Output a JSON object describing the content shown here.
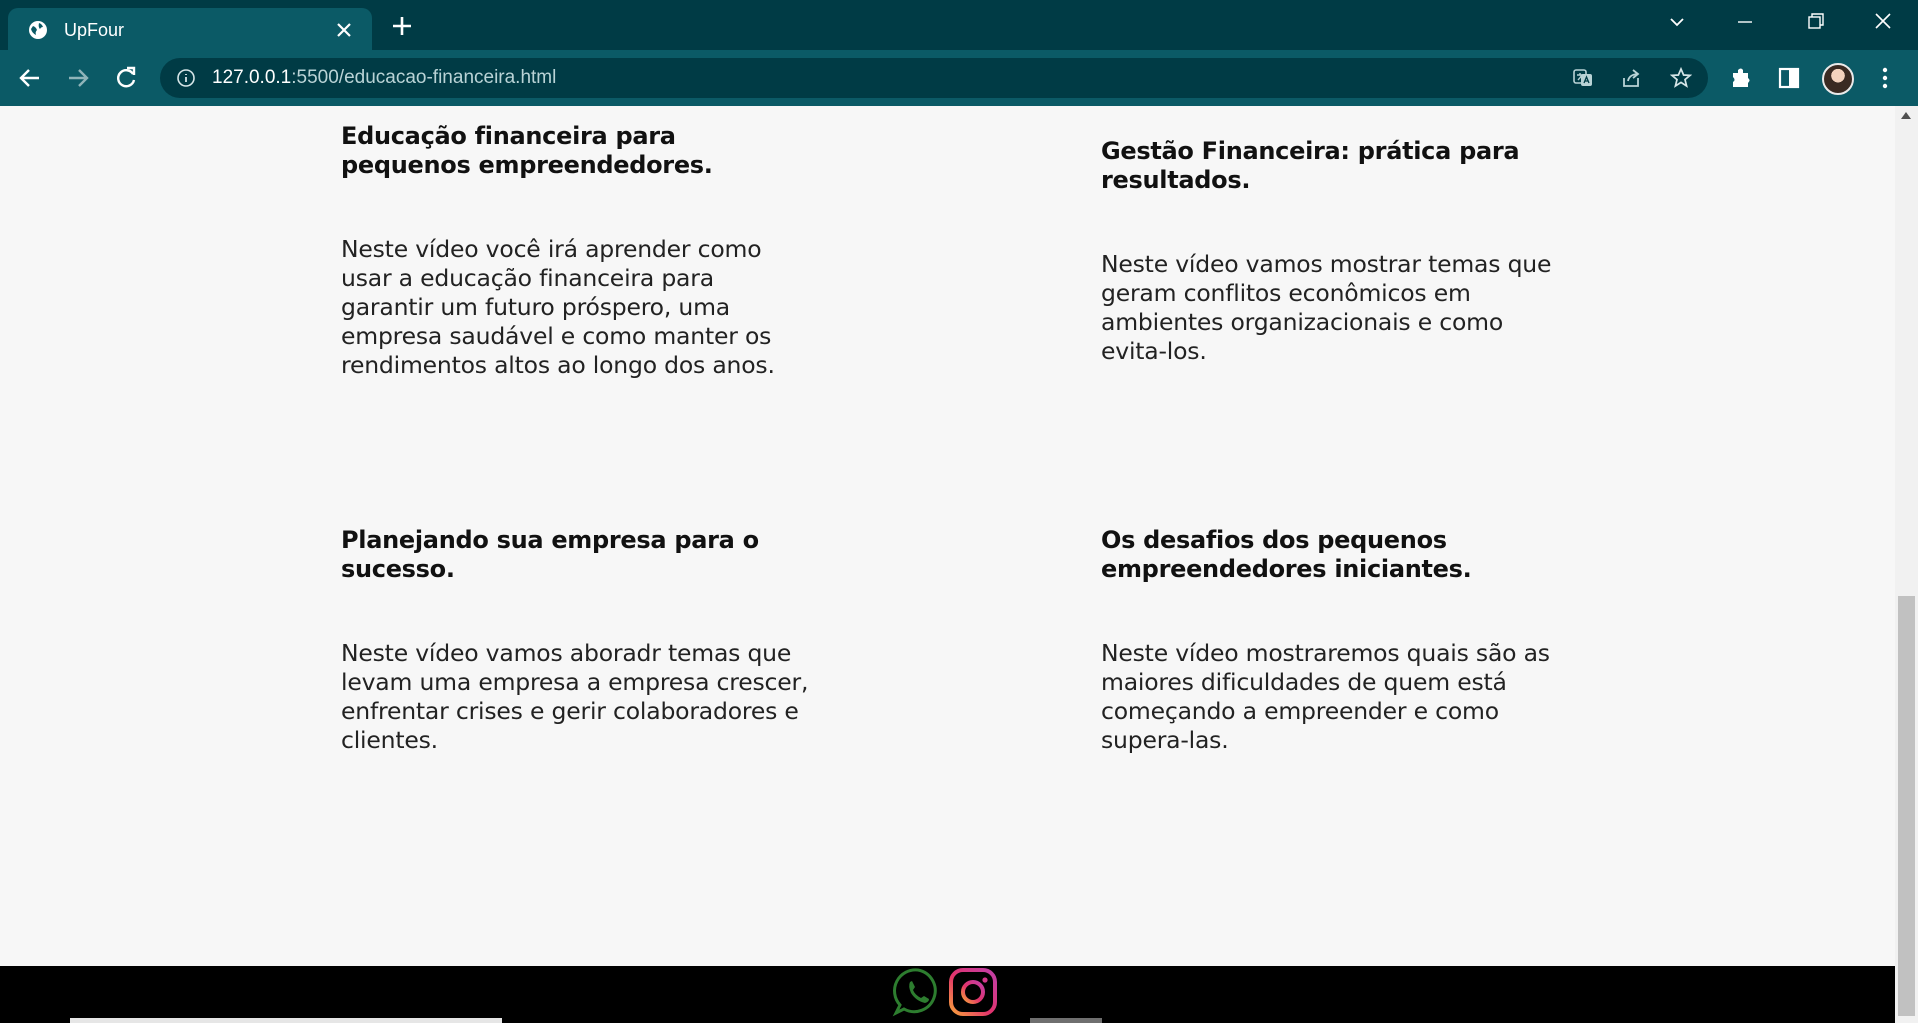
{
  "browser": {
    "tab_title": "UpFour",
    "url_host": "127.0.0.1",
    "url_rest": ":5500/educacao-financeira.html"
  },
  "cards": [
    {
      "title": "Educação financeira para pequenos empreendedores.",
      "text": "Neste vídeo você irá aprender como usar a educação financeira para garantir um futuro próspero, uma empresa saudável e como manter os rendimentos altos ao longo dos anos."
    },
    {
      "title": "Gestão Financeira: prática para resultados.",
      "text": "Neste vídeo vamos mostrar temas que geram conflitos econômicos em ambientes organizacionais e como evita-los."
    },
    {
      "title": "Planejando sua empresa para o sucesso.",
      "text": "Neste vídeo vamos aboradr temas que levam uma empresa a empresa crescer, enfrentar crises e gerir colaboradores e clientes."
    },
    {
      "title": "Os desafios dos pequenos empreendedores iniciantes.",
      "text": "Neste vídeo mostraremos quais são as maiores dificuldades de quem está começando a empreender e como supera-las."
    }
  ],
  "footer": {
    "icons": [
      "whatsapp-icon",
      "instagram-icon"
    ]
  },
  "colors": {
    "tab_strip": "#003b45",
    "toolbar": "#0b5a66",
    "page_bg": "#f7f7f7",
    "footer_bg": "#000000"
  }
}
